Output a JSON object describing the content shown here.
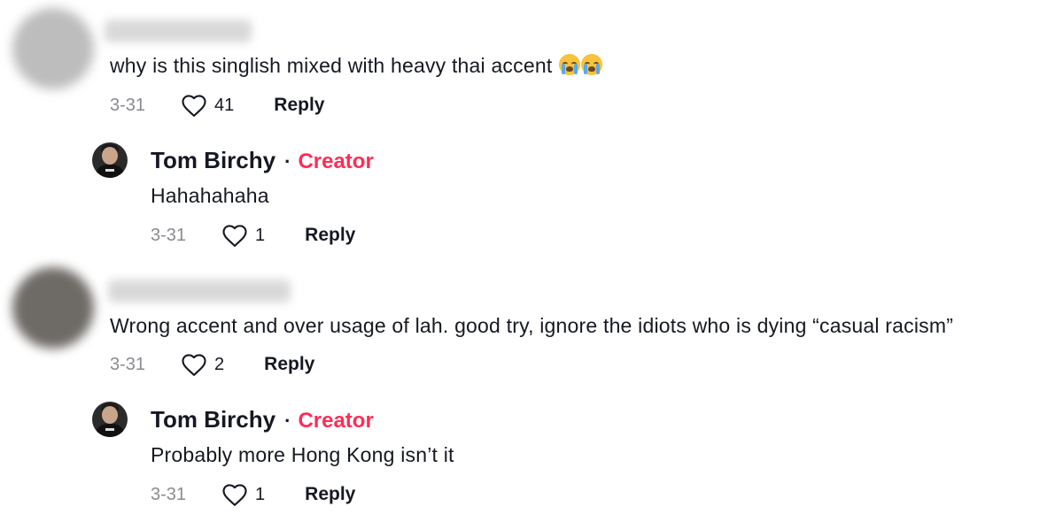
{
  "comments": [
    {
      "text": "why is this singlish mixed with heavy thai accent",
      "emoji": [
        "loudly-crying-face-emoji",
        "loudly-crying-face-emoji"
      ],
      "date": "3-31",
      "likes": "41",
      "reply_label": "Reply",
      "avatar_color": "#bdbdbd"
    },
    {
      "author": "Tom Birchy",
      "separator": "·",
      "badge": "Creator",
      "text": "Hahahahaha",
      "date": "3-31",
      "likes": "1",
      "reply_label": "Reply"
    },
    {
      "text": "Wrong accent and over usage of lah. good try, ignore the idiots who is dying “casual racism”",
      "date": "3-31",
      "likes": "2",
      "reply_label": "Reply",
      "avatar_color": "#6e6a66"
    },
    {
      "author": "Tom Birchy",
      "separator": "·",
      "badge": "Creator",
      "text": "Probably more Hong Kong isn’t it",
      "date": "3-31",
      "likes": "1",
      "reply_label": "Reply"
    }
  ],
  "colors": {
    "creator_badge": "#fe2c55",
    "date_gray": "#8a8b91",
    "text": "#161823"
  },
  "icons": {
    "like": "heart-outline-icon"
  }
}
